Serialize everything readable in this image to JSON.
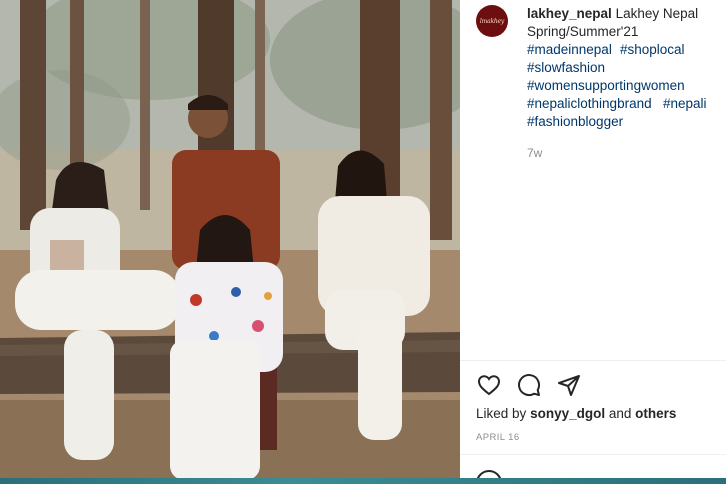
{
  "post": {
    "avatar_text": "lmakhey",
    "username": "lakhey_nepal",
    "caption": "Lakhey Nepal Spring/Summer'21",
    "hashtags": [
      "#madeinnepal",
      "#shoplocal",
      "#slowfashion",
      "#womensupportingwomen",
      "#nepaliclothingbrand",
      "#nepali",
      "#fashionblogger"
    ],
    "time_ago": "7w",
    "likes_prefix": "Liked by",
    "liked_by_user": "sonyy_dgol",
    "likes_and": "and",
    "likes_others": "others",
    "date": "APRIL 16"
  },
  "icons": {
    "like": "heart-icon",
    "comment": "comment-icon",
    "share": "share-icon"
  },
  "colors": {
    "link": "#00376b",
    "text": "#262626",
    "muted": "#8e8e8e",
    "avatar_bg": "#6d0f10"
  }
}
